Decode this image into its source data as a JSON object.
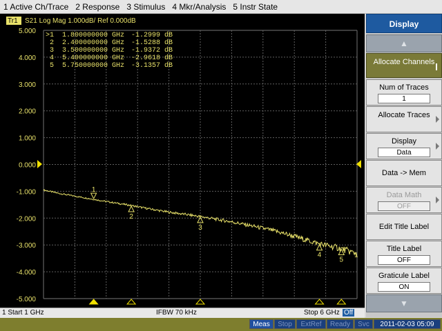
{
  "menu": {
    "items": [
      "1 Active Ch/Trace",
      "2 Response",
      "3 Stimulus",
      "4 Mkr/Analysis",
      "5 Instr State"
    ]
  },
  "trace": {
    "id_badge": "Tr1",
    "header": "S21 Log Mag 1.000dB/ Ref 0.000dB",
    "color": "#e9e26a"
  },
  "markers": [
    {
      "label": ">1",
      "freq": "1.800000000 GHz",
      "value": "-1.2999 dB"
    },
    {
      "label": "2",
      "freq": "2.400000000 GHz",
      "value": "-1.5288 dB"
    },
    {
      "label": "3",
      "freq": "3.500000000 GHz",
      "value": "-1.9372 dB"
    },
    {
      "label": "4",
      "freq": "5.400000000 GHz",
      "value": "-2.9618 dB"
    },
    {
      "label": "5",
      "freq": "5.750000000 GHz",
      "value": "-3.1357 dB"
    }
  ],
  "plot": {
    "y_tick_labels": [
      "5.000",
      "4.000",
      "3.000",
      "2.000",
      "1.000",
      "0.000",
      "-1.000",
      "-2.000",
      "-3.000",
      "-4.000",
      "-5.000"
    ],
    "reference_label": "0.000",
    "end_label": "1"
  },
  "chart_data": {
    "type": "line",
    "xlim": [
      1,
      6
    ],
    "ylim": [
      -5,
      5
    ],
    "grid": true,
    "series": [
      {
        "x": [
          1.0,
          1.25,
          1.5,
          1.8,
          2.0,
          2.4,
          2.7,
          3.0,
          3.2,
          3.5,
          3.8,
          4.0,
          4.3,
          4.6,
          4.8,
          5.0,
          5.2,
          5.4,
          5.6,
          5.75,
          5.9,
          6.0
        ],
        "y": [
          -0.95,
          -1.08,
          -1.18,
          -1.3,
          -1.38,
          -1.53,
          -1.66,
          -1.78,
          -1.84,
          -1.94,
          -2.06,
          -2.14,
          -2.28,
          -2.43,
          -2.55,
          -2.68,
          -2.82,
          -2.96,
          -3.06,
          -3.14,
          -3.26,
          -3.32
        ]
      }
    ],
    "marker_points": [
      {
        "label": "1",
        "x": 1.8,
        "y": -1.2999
      },
      {
        "label": "2",
        "x": 2.4,
        "y": -1.5288
      },
      {
        "label": "3",
        "x": 3.5,
        "y": -1.9372
      },
      {
        "label": "4",
        "x": 5.4,
        "y": -2.9618
      },
      {
        "label": "5",
        "x": 5.75,
        "y": -3.1357
      }
    ]
  },
  "statusbar": {
    "start": "1 Start 1 GHz",
    "ifbw": "IFBW 70 kHz",
    "stop": "Stop 6 GHz",
    "off": "Off"
  },
  "softkeys": {
    "title": "Display",
    "allocate_channels": "Allocate Channels",
    "num_traces": {
      "label": "Num of Traces",
      "value": "1"
    },
    "allocate_traces": "Allocate Traces",
    "display": {
      "label": "Display",
      "value": "Data"
    },
    "data_mem": "Data -> Mem",
    "data_math": {
      "label": "Data Math",
      "value": "OFF"
    },
    "edit_title": "Edit Title Label",
    "title_label": {
      "label": "Title Label",
      "value": "OFF"
    },
    "graticule_label": {
      "label": "Graticule Label",
      "value": "ON"
    }
  },
  "bottom": {
    "meas": "Meas",
    "stop": "Stop",
    "extref": "ExtRef",
    "ready": "Ready",
    "svc": "Svc",
    "datetime": "2011-02-03 05:09"
  }
}
